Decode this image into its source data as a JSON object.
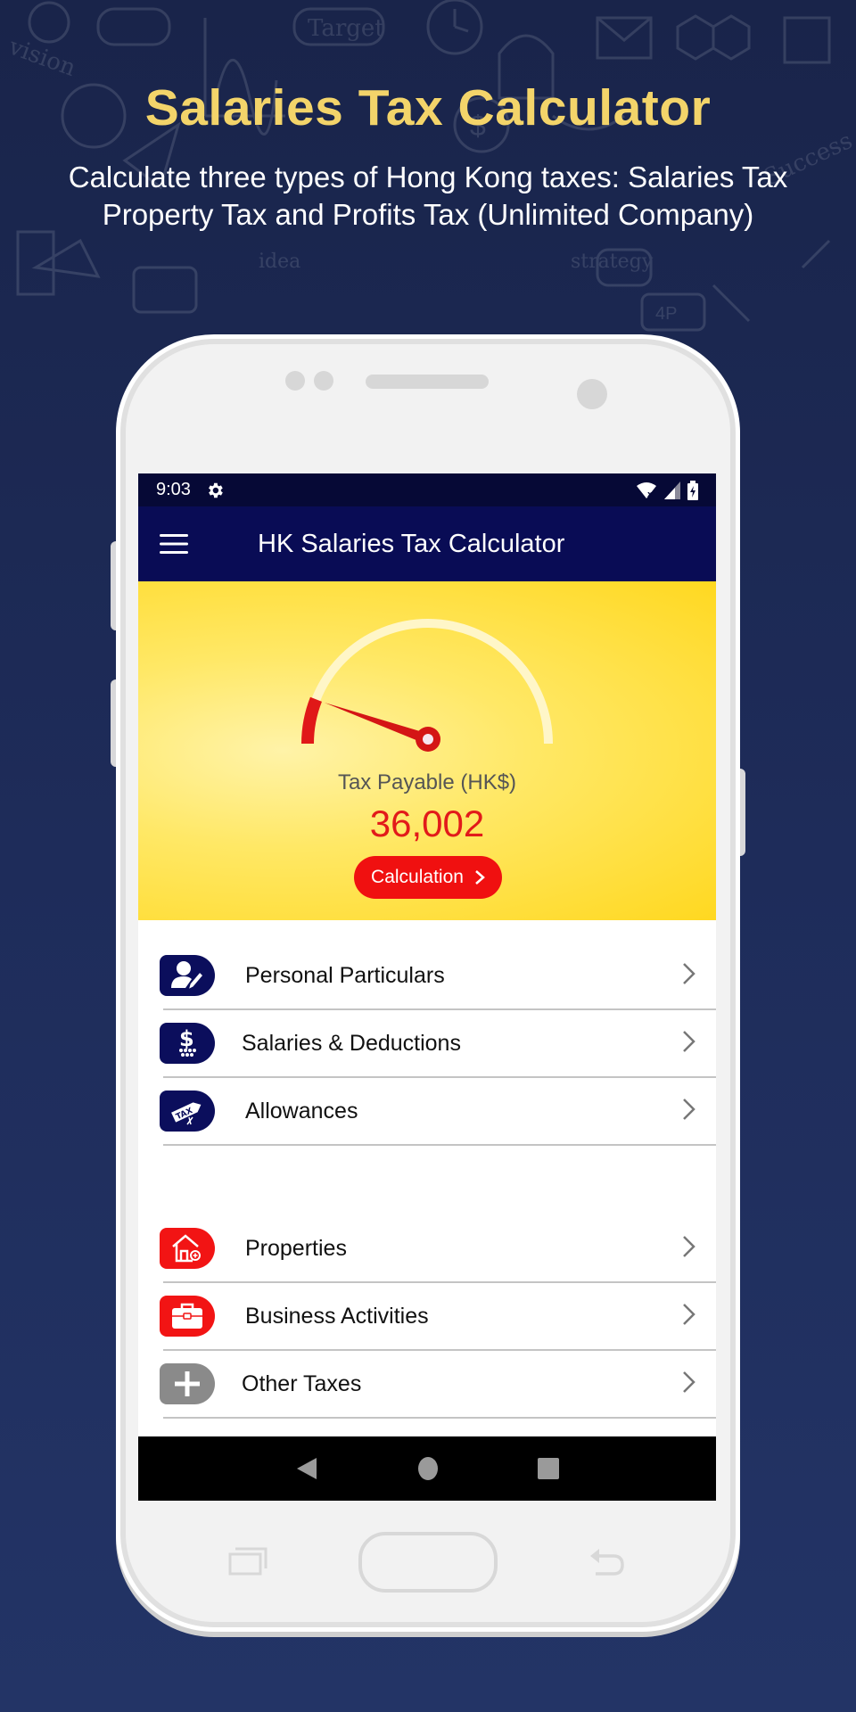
{
  "promo": {
    "title": "Salaries Tax Calculator",
    "subtitle_line1": "Calculate three types of Hong Kong taxes: Salaries Tax",
    "subtitle_line2": "Property Tax and Profits Tax (Unlimited Company)"
  },
  "colors": {
    "accent_yellow": "#f3d46a",
    "app_bar": "#090c55",
    "status_bar": "#060936",
    "primary_red": "#f01010",
    "icon_navy": "#0b0e5c",
    "icon_grey": "#8a8a8a"
  },
  "statusbar": {
    "time": "9:03",
    "icons": [
      "settings-gear-icon",
      "wifi-off-icon",
      "signal-icon",
      "battery-charging-icon"
    ]
  },
  "appbar": {
    "menu_icon": "hamburger-menu-icon",
    "title": "HK Salaries Tax Calculator"
  },
  "summary": {
    "gauge_fraction": 0.12,
    "tax_label": "Tax Payable (HK$)",
    "tax_value": "36,002",
    "calc_button": "Calculation"
  },
  "menu": {
    "salaries_group": [
      {
        "label": "Personal Particulars",
        "icon": "person-edit-icon"
      },
      {
        "label": "Salaries & Deductions",
        "icon": "dollar-coins-icon"
      },
      {
        "label": "Allowances",
        "icon": "tax-tag-icon"
      }
    ],
    "other_group": [
      {
        "label": "Properties",
        "icon": "house-icon"
      },
      {
        "label": "Business Activities",
        "icon": "briefcase-icon"
      },
      {
        "label": "Other Taxes",
        "icon": "plus-icon"
      }
    ]
  },
  "navbar": {
    "icons": [
      "back-icon",
      "home-icon",
      "recents-icon"
    ]
  }
}
